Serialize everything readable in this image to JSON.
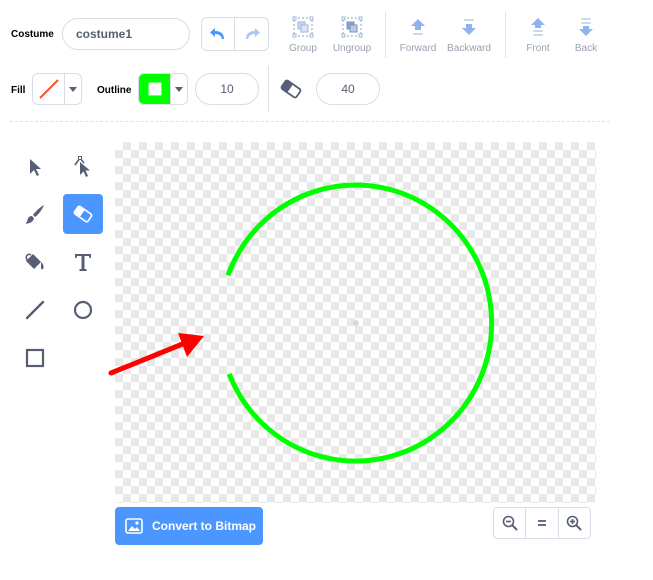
{
  "costume": {
    "label": "Costume",
    "name_value": "costume1"
  },
  "toolbar": {
    "undo_icon": "undo-arrow-icon",
    "redo_icon": "redo-arrow-icon",
    "group_label": "Group",
    "ungroup_label": "Ungroup",
    "forward_label": "Forward",
    "backward_label": "Backward",
    "front_label": "Front",
    "back_label": "Back"
  },
  "fill": {
    "label": "Fill",
    "state": "none",
    "none_indicator_color": "#ff4f2b"
  },
  "outline": {
    "label": "Outline",
    "color": "#00ff00",
    "width_value": "10"
  },
  "eraser": {
    "size_value": "40"
  },
  "tools": [
    {
      "name": "select-tool",
      "icon": "arrow-cursor-icon",
      "active": false
    },
    {
      "name": "reshape-tool",
      "icon": "reshape-cursor-icon",
      "active": false
    },
    {
      "name": "brush-tool",
      "icon": "brush-icon",
      "active": false
    },
    {
      "name": "eraser-tool",
      "icon": "eraser-icon",
      "active": true
    },
    {
      "name": "fill-tool",
      "icon": "paint-bucket-icon",
      "active": false
    },
    {
      "name": "text-tool",
      "icon": "text-t-icon",
      "active": false
    },
    {
      "name": "line-tool",
      "icon": "line-icon",
      "active": false
    },
    {
      "name": "circle-tool",
      "icon": "circle-icon",
      "active": false
    },
    {
      "name": "rectangle-tool",
      "icon": "rectangle-icon",
      "active": false
    }
  ],
  "canvas": {
    "shape_color": "#00ff00",
    "arrow_color": "#ff0000"
  },
  "convert_button": {
    "label": "Convert to Bitmap",
    "icon": "image-icon"
  },
  "zoom": {
    "zoom_out_icon": "zoom-out-icon",
    "reset_icon": "zoom-reset-icon",
    "zoom_in_icon": "zoom-in-icon"
  },
  "colors": {
    "accent": "#4c97ff",
    "text": "#575e75"
  }
}
